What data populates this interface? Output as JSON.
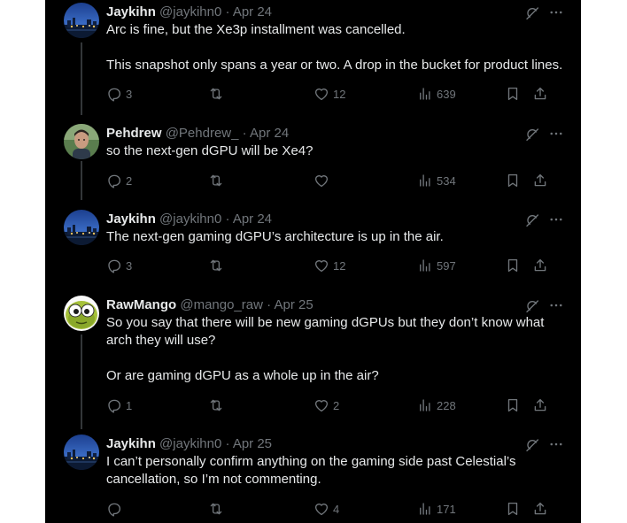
{
  "tweets": [
    {
      "name": "Jaykihn",
      "handle": "@jaykihn0",
      "date": "Apr 24",
      "text": "Arc is fine, but the Xe3p installment was cancelled.\n\nThis snapshot only spans a year or two. A drop in the bucket for product lines.",
      "replies": "3",
      "retweets": "",
      "likes": "12",
      "views": "639"
    },
    {
      "name": "Pehdrew",
      "handle": "@Pehdrew_",
      "date": "Apr 24",
      "text": "so the next-gen dGPU will be Xe4?",
      "replies": "2",
      "retweets": "",
      "likes": "",
      "views": "534"
    },
    {
      "name": "Jaykihn",
      "handle": "@jaykihn0",
      "date": "Apr 24",
      "text": "The next-gen gaming dGPU’s architecture is up in the air.",
      "replies": "3",
      "retweets": "",
      "likes": "12",
      "views": "597"
    },
    {
      "name": "RawMango",
      "handle": "@mango_raw",
      "date": "Apr 25",
      "text": "So you say that there will be new gaming dGPUs but they don’t know what arch they will use?\n\nOr are gaming dGPU as a whole up in the air?",
      "replies": "1",
      "retweets": "",
      "likes": "2",
      "views": "228"
    },
    {
      "name": "Jaykihn",
      "handle": "@jaykihn0",
      "date": "Apr 25",
      "text": "I can’t personally confirm anything on the gaming side past Celestial’s cancellation, so I’m not commenting.",
      "replies": "",
      "retweets": "",
      "likes": "4",
      "views": "171"
    }
  ],
  "separator": " · ",
  "icons": {
    "reply": "reply-icon",
    "retweet": "retweet-icon",
    "like": "heart-icon",
    "views": "views-chart-icon",
    "bookmark": "bookmark-icon",
    "share": "share-icon",
    "grok": "grok-icon",
    "more": "more-icon"
  },
  "colors": {
    "background": "#000000",
    "text": "#e7e9ea",
    "muted": "#71767b",
    "thread_line": "#333639"
  }
}
